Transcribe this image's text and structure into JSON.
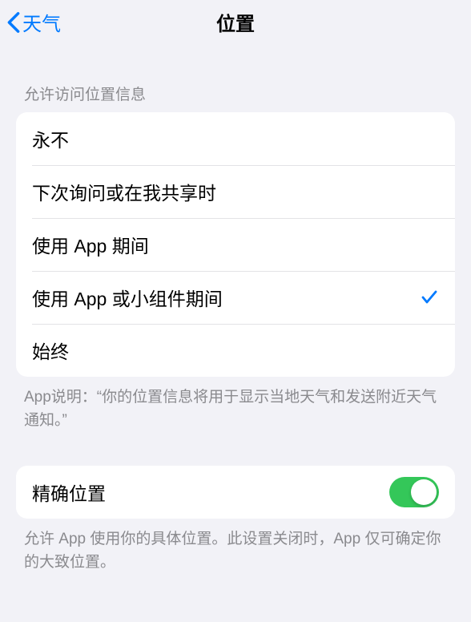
{
  "nav": {
    "back_label": "天气",
    "title": "位置"
  },
  "section1": {
    "header": "允许访问位置信息",
    "options": [
      {
        "label": "永不",
        "selected": false
      },
      {
        "label": "下次询问或在我共享时",
        "selected": false
      },
      {
        "label": "使用 App 期间",
        "selected": false
      },
      {
        "label": "使用 App 或小组件期间",
        "selected": true
      },
      {
        "label": "始终",
        "selected": false
      }
    ],
    "footer": "App说明：“你的位置信息将用于显示当地天气和发送附近天气通知。”"
  },
  "section2": {
    "item_label": "精确位置",
    "toggle_on": true,
    "footer": "允许 App 使用你的具体位置。此设置关闭时，App 仅可确定你的大致位置。"
  }
}
